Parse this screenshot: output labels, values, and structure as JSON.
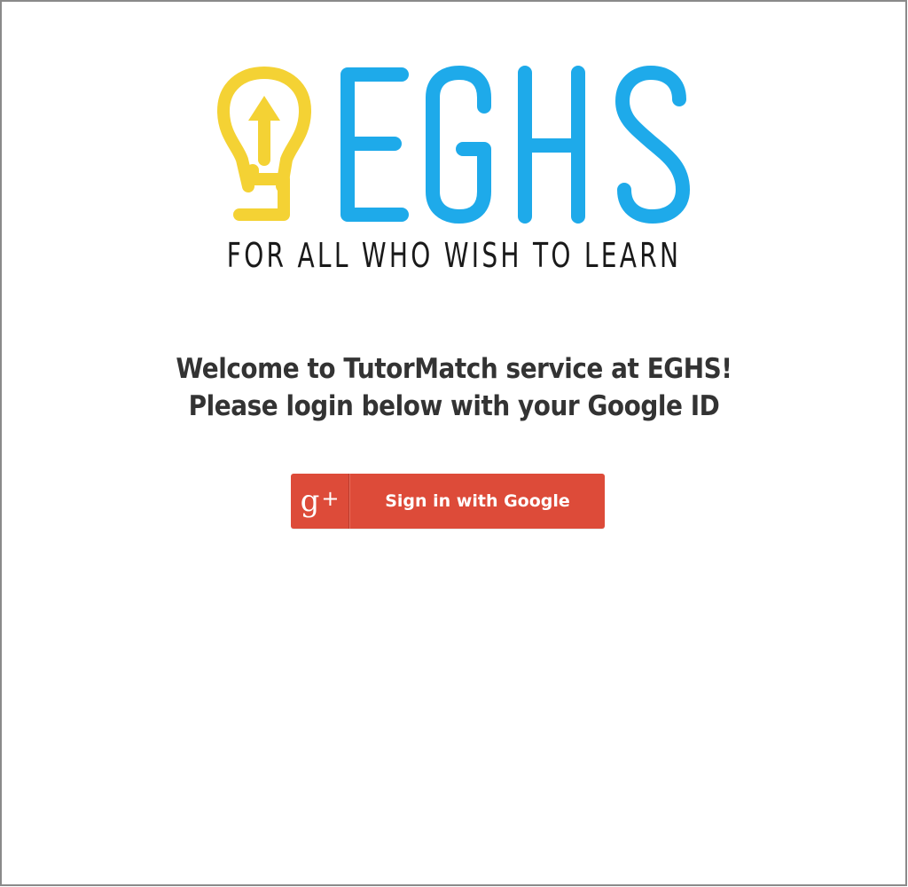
{
  "logo": {
    "wordmark": "EGHS",
    "tagline": "FOR ALL WHO WISH TO LEARN",
    "bulb_color": "#f4d234",
    "wordmark_color": "#1eaaea",
    "icon": "lightbulb-arrow-icon"
  },
  "welcome": {
    "line1": "Welcome to TutorMatch service at EGHS!",
    "line2": "Please login below with your Google ID"
  },
  "signin": {
    "icon_g": "g",
    "icon_plus": "+",
    "label": "Sign in with Google",
    "color": "#dd4b39",
    "icon": "google-plus-icon"
  }
}
